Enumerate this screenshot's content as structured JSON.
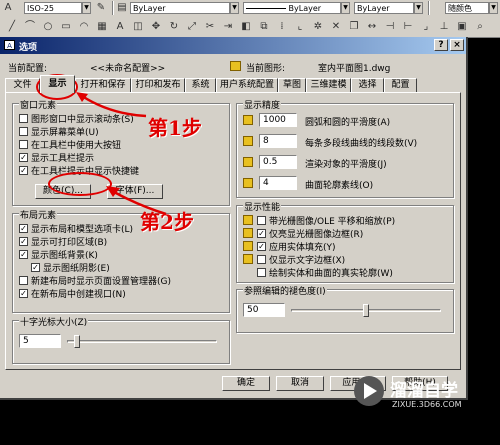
{
  "toolbar": {
    "linetype_scale": "ISO-25",
    "layer1": "ByLayer",
    "layer2": "ByLayer",
    "layer3": "ByLayer",
    "color": "随颜色"
  },
  "dialog": {
    "title": "选项",
    "current_profile_label": "当前配置:",
    "current_profile_value": "<<未命名配置>>",
    "current_drawing_label": "当前图形:",
    "current_drawing_value": "室内平面图1.dwg"
  },
  "tabs": [
    {
      "label": "文件"
    },
    {
      "label": "显示"
    },
    {
      "label": "打开和保存"
    },
    {
      "label": "打印和发布"
    },
    {
      "label": "系统"
    },
    {
      "label": "用户系统配置"
    },
    {
      "label": "草图"
    },
    {
      "label": "三维建模"
    },
    {
      "label": "选择"
    },
    {
      "label": "配置"
    }
  ],
  "window_elements": {
    "title": "窗口元素",
    "checkboxes": [
      {
        "label": "图形窗口中显示滚动条(S)",
        "checked": false
      },
      {
        "label": "显示屏幕菜单(U)",
        "checked": false
      },
      {
        "label": "在工具栏中使用大按钮",
        "checked": false
      },
      {
        "label": "显示工具栏提示",
        "checked": true
      },
      {
        "label": "在工具栏提示中显示快捷键",
        "checked": true
      }
    ],
    "colors_button": "颜色(C)...",
    "fonts_button": "字体(F)..."
  },
  "layout_elements": {
    "title": "布局元素",
    "checkboxes": [
      {
        "label": "显示布局和模型选项卡(L)",
        "checked": true
      },
      {
        "label": "显示可打印区域(B)",
        "checked": true
      },
      {
        "label": "显示图纸背景(K)",
        "checked": true
      },
      {
        "label": "显示图纸阴影(E)",
        "checked": true
      },
      {
        "label": "新建布局时显示页面设置管理器(G)",
        "checked": false
      },
      {
        "label": "在新布局中创建视口(N)",
        "checked": true
      }
    ]
  },
  "crosshair": {
    "title": "十字光标大小(Z)",
    "value": "5",
    "slider_fraction": 0.05
  },
  "display_resolution": {
    "title": "显示精度",
    "rows": [
      {
        "value": "1000",
        "label": "圆弧和圆的平滑度(A)"
      },
      {
        "value": "8",
        "label": "每条多段线曲线的线段数(V)"
      },
      {
        "value": "0.5",
        "label": "渲染对象的平滑度(J)"
      },
      {
        "value": "4",
        "label": "曲面轮廓素线(O)"
      }
    ]
  },
  "display_performance": {
    "title": "显示性能",
    "checkboxes": [
      {
        "label": "带光栅图像/OLE 平移和缩放(P)",
        "checked": false
      },
      {
        "label": "仅亮显光栅图像边框(R)",
        "checked": true
      },
      {
        "label": "应用实体填充(Y)",
        "checked": true
      },
      {
        "label": "仅显示文字边框(X)",
        "checked": false
      },
      {
        "label": "绘制实体和曲面的真实轮廓(W)",
        "checked": false
      }
    ]
  },
  "xref_fade": {
    "title": "参照编辑的褪色度(I)",
    "value": "50",
    "slider_fraction": 0.5
  },
  "buttons": {
    "ok": "确定",
    "cancel": "取消",
    "apply": "应用(A)",
    "help": "帮助(H)"
  },
  "annotations": {
    "step1": "第1步",
    "step2": "第2步"
  },
  "watermark": {
    "brand": "溜溜自学",
    "url": "ZIXUE.3D66.COM"
  },
  "colors": {
    "annotation_red": "#e00000",
    "title_blue": "#0a246a",
    "dialog_gray": "#d4d0c8",
    "watermark_gray": "#555555"
  }
}
